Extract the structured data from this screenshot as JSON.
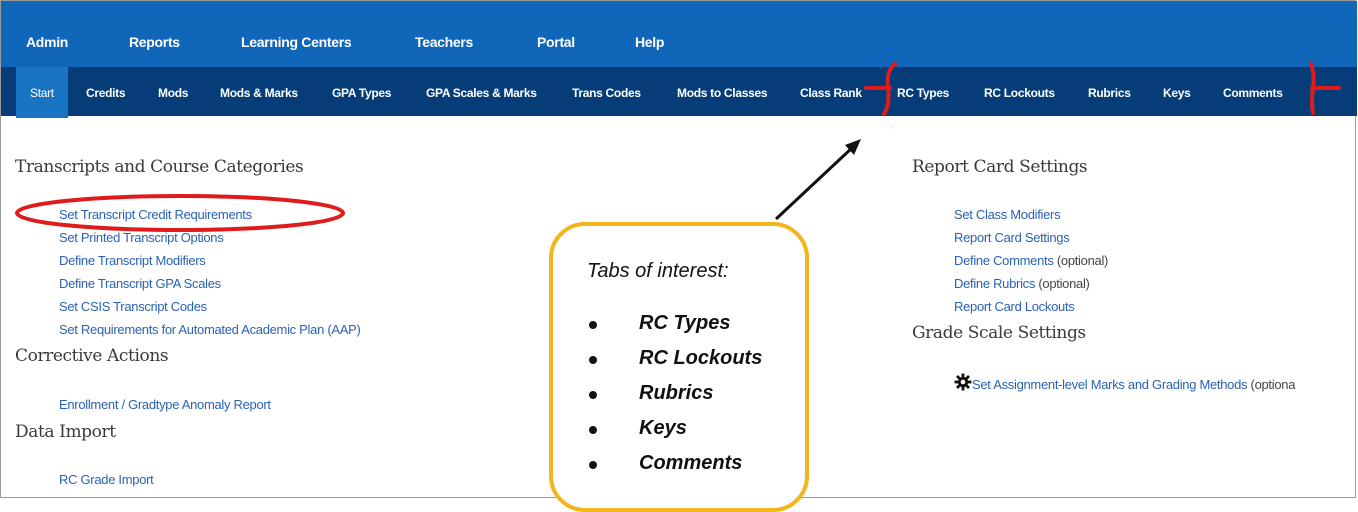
{
  "top_menu": [
    "Admin",
    "Reports",
    "Learning Centers",
    "Teachers",
    "Portal",
    "Help"
  ],
  "tabs": [
    "Start",
    "Credits",
    "Mods",
    "Mods & Marks",
    "GPA Types",
    "GPA Scales & Marks",
    "Trans Codes",
    "Mods to Classes",
    "Class Rank",
    "RC Types",
    "RC Lockouts",
    "Rubrics",
    "Keys",
    "Comments"
  ],
  "left": {
    "transcripts_heading": "Transcripts and Course Categories",
    "transcripts_links": [
      "Set Transcript Credit Requirements",
      "Set Printed Transcript Options",
      "Define Transcript Modifiers",
      "Define Transcript GPA Scales",
      "Set CSIS Transcript Codes",
      "Set Requirements for Automated Academic Plan (AAP)"
    ],
    "corrective_heading": "Corrective Actions",
    "corrective_links": [
      "Enrollment / Gradtype Anomaly Report"
    ],
    "import_heading": "Data Import",
    "import_links": [
      "RC Grade Import"
    ]
  },
  "right": {
    "report_card_heading": "Report Card Settings",
    "report_card_links": [
      {
        "label": "Set Class Modifiers",
        "note": ""
      },
      {
        "label": "Report Card Settings",
        "note": ""
      },
      {
        "label": "Define Comments",
        "note": " (optional)"
      },
      {
        "label": "Define Rubrics",
        "note": " (optional)"
      },
      {
        "label": "Report Card Lockouts",
        "note": ""
      }
    ],
    "grade_scale_heading": "Grade Scale Settings",
    "grade_scale_link": "Set Assignment-level Marks and Grading Methods",
    "grade_scale_note": " (optiona"
  },
  "callout": {
    "title": "Tabs of interest:",
    "items": [
      "RC Types",
      "RC Lockouts",
      "Rubrics",
      "Keys",
      "Comments"
    ]
  },
  "icons": {
    "grade_scale": "gear-icon"
  },
  "colors": {
    "topnav": "#1066b8",
    "tabbar": "#063d78",
    "active_tab": "#1a74c4",
    "link": "#2a62b4",
    "annotation_red": "#e01b1b",
    "callout_border": "#f2b51c"
  }
}
